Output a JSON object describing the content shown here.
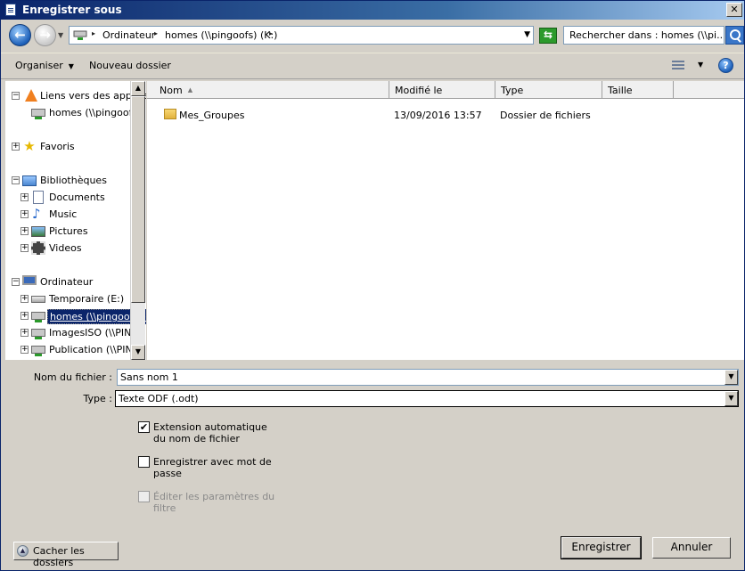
{
  "window": {
    "title": "Enregistrer sous",
    "close_label": "✕"
  },
  "nav": {
    "back_label": "←",
    "forward_label": "→",
    "address_segments": [
      "Ordinateur",
      "homes (\\\\pingoofs) (K:)"
    ],
    "search_placeholder": "Rechercher dans : homes (\\\\pi..."
  },
  "toolbar": {
    "organize_label": "Organiser",
    "new_folder_label": "Nouveau dossier",
    "help_label": "?"
  },
  "tree": {
    "items": [
      {
        "label": "Liens vers des applica",
        "icon": "vlc-cone-icon",
        "expander": "−",
        "indent": 0
      },
      {
        "label": "homes (\\\\pingoofs)",
        "icon": "network-drive-icon",
        "expander": "",
        "indent": 1
      },
      {
        "label": "Favoris",
        "icon": "star-icon",
        "expander": "+",
        "indent": 0
      },
      {
        "label": "Bibliothèques",
        "icon": "library-icon",
        "expander": "−",
        "indent": 0
      },
      {
        "label": "Documents",
        "icon": "document-icon",
        "expander": "+",
        "indent": 1
      },
      {
        "label": "Music",
        "icon": "music-icon",
        "expander": "+",
        "indent": 1
      },
      {
        "label": "Pictures",
        "icon": "pictures-icon",
        "expander": "+",
        "indent": 1
      },
      {
        "label": "Videos",
        "icon": "video-icon",
        "expander": "+",
        "indent": 1
      },
      {
        "label": "Ordinateur",
        "icon": "computer-icon",
        "expander": "−",
        "indent": 0
      },
      {
        "label": "Temporaire (E:)",
        "icon": "drive-icon",
        "expander": "+",
        "indent": 1
      },
      {
        "label": "homes (\\\\pingoofs) (K:)",
        "icon": "network-drive-icon",
        "expander": "+",
        "indent": 1,
        "selected": true
      },
      {
        "label": "ImagesISO (\\\\PING",
        "icon": "network-drive-icon",
        "expander": "+",
        "indent": 1
      },
      {
        "label": "Publication (\\\\PING",
        "icon": "network-drive-icon",
        "expander": "+",
        "indent": 1
      }
    ]
  },
  "list": {
    "columns": [
      "Nom",
      "Modifié le",
      "Type",
      "Taille"
    ],
    "rows": [
      {
        "name": "Mes_Groupes",
        "modified": "13/09/2016 13:57",
        "type": "Dossier de fichiers",
        "size": ""
      }
    ]
  },
  "form": {
    "filename_label": "Nom du fichier :",
    "filename_value": "Sans nom 1",
    "type_label": "Type :",
    "type_value": "Texte ODF (.odt)",
    "options": [
      {
        "label": "Extension automatique du nom de fichier",
        "checked": true,
        "disabled": false
      },
      {
        "label": "Enregistrer avec mot de passe",
        "checked": false,
        "disabled": false
      },
      {
        "label": "Éditer les paramètres du filtre",
        "checked": false,
        "disabled": true
      }
    ]
  },
  "buttons": {
    "hide_folders": "Cacher les dossiers",
    "save": "Enregistrer",
    "cancel": "Annuler"
  },
  "colors": {
    "selection": "#0a246a",
    "title_bar": "#0a246a",
    "dialog_bg": "#d4d0c8"
  }
}
